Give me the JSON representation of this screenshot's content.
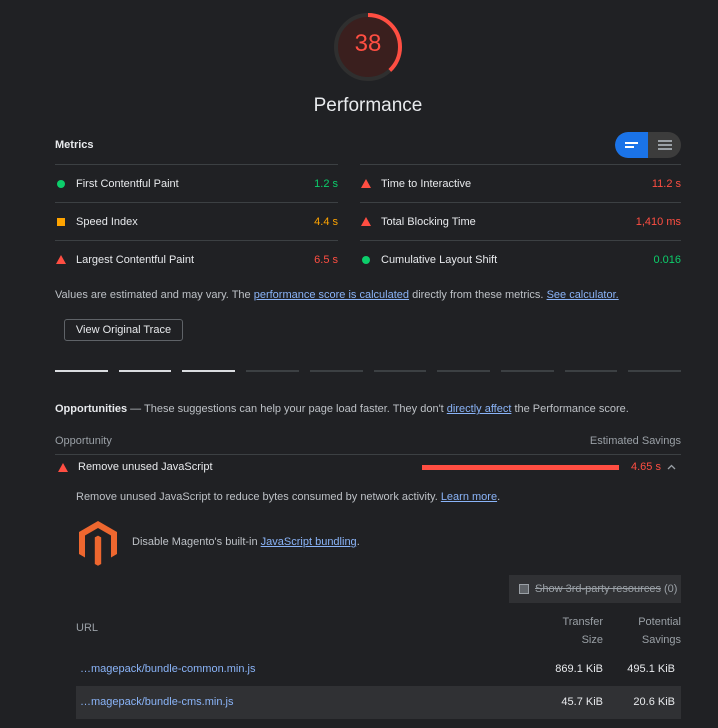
{
  "colors": {
    "pass": "#0cce6b",
    "average": "#ffa400",
    "fail": "#ff4e42",
    "link": "#8ab4f8",
    "accent": "#1a73e8"
  },
  "gauge": {
    "score": "38",
    "score_fraction": 0.38,
    "title": "Performance"
  },
  "metrics": {
    "title": "Metrics",
    "left": [
      {
        "icon": "pass-circle-icon",
        "name": "First Contentful Paint",
        "value": "1.2 s",
        "status": "green"
      },
      {
        "icon": "average-square-icon",
        "name": "Speed Index",
        "value": "4.4 s",
        "status": "orange"
      },
      {
        "icon": "fail-triangle-icon",
        "name": "Largest Contentful Paint",
        "value": "6.5 s",
        "status": "red"
      }
    ],
    "right": [
      {
        "icon": "fail-triangle-icon",
        "name": "Time to Interactive",
        "value": "11.2 s",
        "status": "red"
      },
      {
        "icon": "fail-triangle-icon",
        "name": "Total Blocking Time",
        "value": "1,410 ms",
        "status": "red"
      },
      {
        "icon": "pass-circle-icon",
        "name": "Cumulative Layout Shift",
        "value": "0.016",
        "status": "green"
      }
    ],
    "note_prefix": "Values are estimated and may vary. The ",
    "note_link1": "performance score is calculated",
    "note_middle": " directly from these metrics. ",
    "note_link2": "See calculator."
  },
  "trace_button": "View Original Trace",
  "filmstrip": {
    "frames_loaded": 3,
    "frames_total": 10
  },
  "opportunities": {
    "title": "Opportunities",
    "desc_prefix": " — These suggestions can help your page load faster. They don't ",
    "desc_link": "directly affect",
    "desc_suffix": " the Performance score.",
    "col_opportunity": "Opportunity",
    "col_savings": "Estimated Savings",
    "item": {
      "title": "Remove unused JavaScript",
      "savings": "4.65 s",
      "description": "Remove unused JavaScript to reduce bytes consumed by network activity. ",
      "learn_more": "Learn more",
      "desc_end": ".",
      "stack_pack_text": "Disable Magento's built-in ",
      "stack_pack_link": "JavaScript bundling",
      "stack_pack_end": ".",
      "third_party_label": "Show 3rd-party resources",
      "third_party_count": "(0)",
      "table": {
        "col_url": "URL",
        "col_transfer_1": "Transfer",
        "col_transfer_2": "Size",
        "col_potential_1": "Potential",
        "col_potential_2": "Savings",
        "rows": [
          {
            "url": "…magepack/bundle-common.min.js",
            "transfer": "869.1 KiB",
            "potential": "495.1 KiB"
          },
          {
            "url": "…magepack/bundle-cms.min.js",
            "transfer": "45.7 KiB",
            "potential": "20.6 KiB"
          }
        ]
      }
    }
  }
}
